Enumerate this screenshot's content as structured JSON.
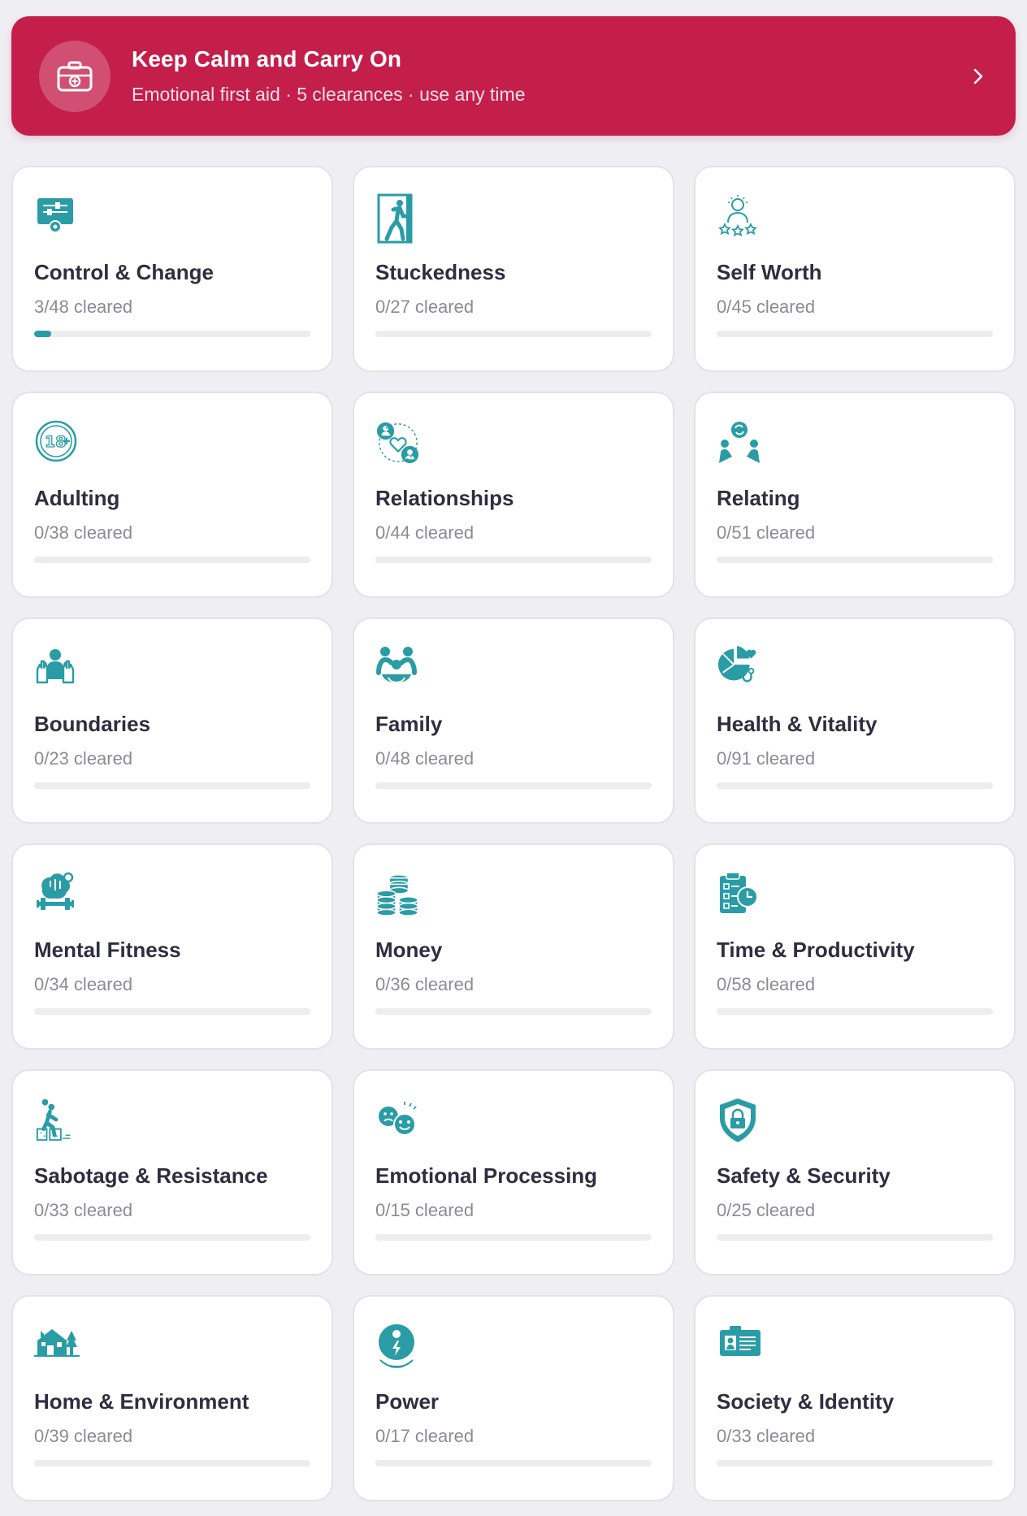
{
  "banner": {
    "title": "Keep Calm and Carry On",
    "subtitle": "Emotional first aid · 5 clearances · use any time",
    "icon": "first-aid-kit-icon",
    "color": "#c41e4b"
  },
  "accent_color": "#2a9ca6",
  "categories": [
    {
      "title": "Control & Change",
      "sub": "3/48 cleared",
      "progress": 0.0625,
      "icon": "control-panel-gear-icon"
    },
    {
      "title": "Stuckedness",
      "sub": "0/27 cleared",
      "progress": 0,
      "icon": "person-in-doorway-icon"
    },
    {
      "title": "Self Worth",
      "sub": "0/45 cleared",
      "progress": 0,
      "icon": "person-stars-icon"
    },
    {
      "title": "Adulting",
      "sub": "0/38 cleared",
      "progress": 0,
      "icon": "eighteen-plus-icon"
    },
    {
      "title": "Relationships",
      "sub": "0/44 cleared",
      "progress": 0,
      "icon": "couple-heart-icon"
    },
    {
      "title": "Relating",
      "sub": "0/51 cleared",
      "progress": 0,
      "icon": "two-people-exchange-icon"
    },
    {
      "title": "Boundaries",
      "sub": "0/23 cleared",
      "progress": 0,
      "icon": "person-hands-icon"
    },
    {
      "title": "Family",
      "sub": "0/48 cleared",
      "progress": 0,
      "icon": "family-group-icon"
    },
    {
      "title": "Health & Vitality",
      "sub": "0/91 cleared",
      "progress": 0,
      "icon": "health-chart-stethoscope-icon"
    },
    {
      "title": "Mental Fitness",
      "sub": "0/34 cleared",
      "progress": 0,
      "icon": "brain-dumbbell-icon"
    },
    {
      "title": "Money",
      "sub": "0/36 cleared",
      "progress": 0,
      "icon": "coin-stacks-icon"
    },
    {
      "title": "Time & Productivity",
      "sub": "0/58 cleared",
      "progress": 0,
      "icon": "checklist-clock-icon"
    },
    {
      "title": "Sabotage & Resistance",
      "sub": "0/33 cleared",
      "progress": 0,
      "icon": "person-stumbling-icon"
    },
    {
      "title": "Emotional Processing",
      "sub": "0/15 cleared",
      "progress": 0,
      "icon": "sad-happy-faces-icon"
    },
    {
      "title": "Safety & Security",
      "sub": "0/25 cleared",
      "progress": 0,
      "icon": "shield-lock-icon"
    },
    {
      "title": "Home & Environment",
      "sub": "0/39 cleared",
      "progress": 0,
      "icon": "house-trees-icon"
    },
    {
      "title": "Power",
      "sub": "0/17 cleared",
      "progress": 0,
      "icon": "person-lightning-icon"
    },
    {
      "title": "Society & Identity",
      "sub": "0/33 cleared",
      "progress": 0,
      "icon": "id-card-icon"
    }
  ]
}
